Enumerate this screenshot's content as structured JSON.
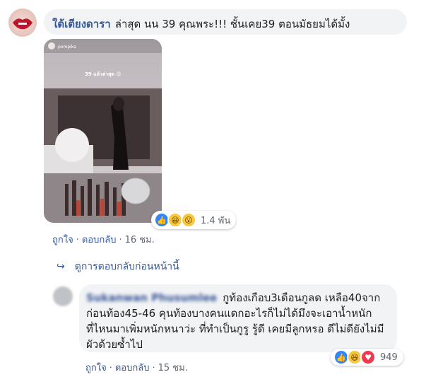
{
  "comment": {
    "author": "ใต้เตียงดารา",
    "text": "ล่าสุด นน 39 คุณพระ!!! ชั้นเคย39 ตอนมัธยมได้มั้ง",
    "photo": {
      "username": "pompika",
      "caption": "39 แล้วล่าสุด 😊"
    },
    "reaction_count": "1.4 พัน",
    "reactions": [
      "like",
      "haha",
      "wow"
    ],
    "actions": {
      "like": "ถูกใจ",
      "reply": "ตอบกลับ",
      "time": "16 ชม."
    }
  },
  "view_previous_replies": "ดูการตอบกลับก่อนหน้านี้",
  "reply": {
    "author": "Sukanwan Phusumlee",
    "text": "กูท้องเกือบ3เดือนกูลด เหลือ40จากก่อนท้อง45-46 คุนท้องบางคนแดกอะไรก็ไม่ได้มึงจะเอาน้ำหนักที่ไหนมาเพิ่มหนักหนาว่ะ ที่ทำเป็นกูรู รู้ดี เคยมีลูกหรอ ดีไม่ดียังไม่มีผัวด้วยซ้ำไป",
    "reaction_count": "949",
    "reactions": [
      "like",
      "haha",
      "love"
    ],
    "actions": {
      "like": "ถูกใจ",
      "reply": "ตอบกลับ",
      "time": "15 ชม."
    }
  },
  "colors": {
    "link": "#385898",
    "bubble": "#f2f3f5",
    "meta": "#606770"
  }
}
